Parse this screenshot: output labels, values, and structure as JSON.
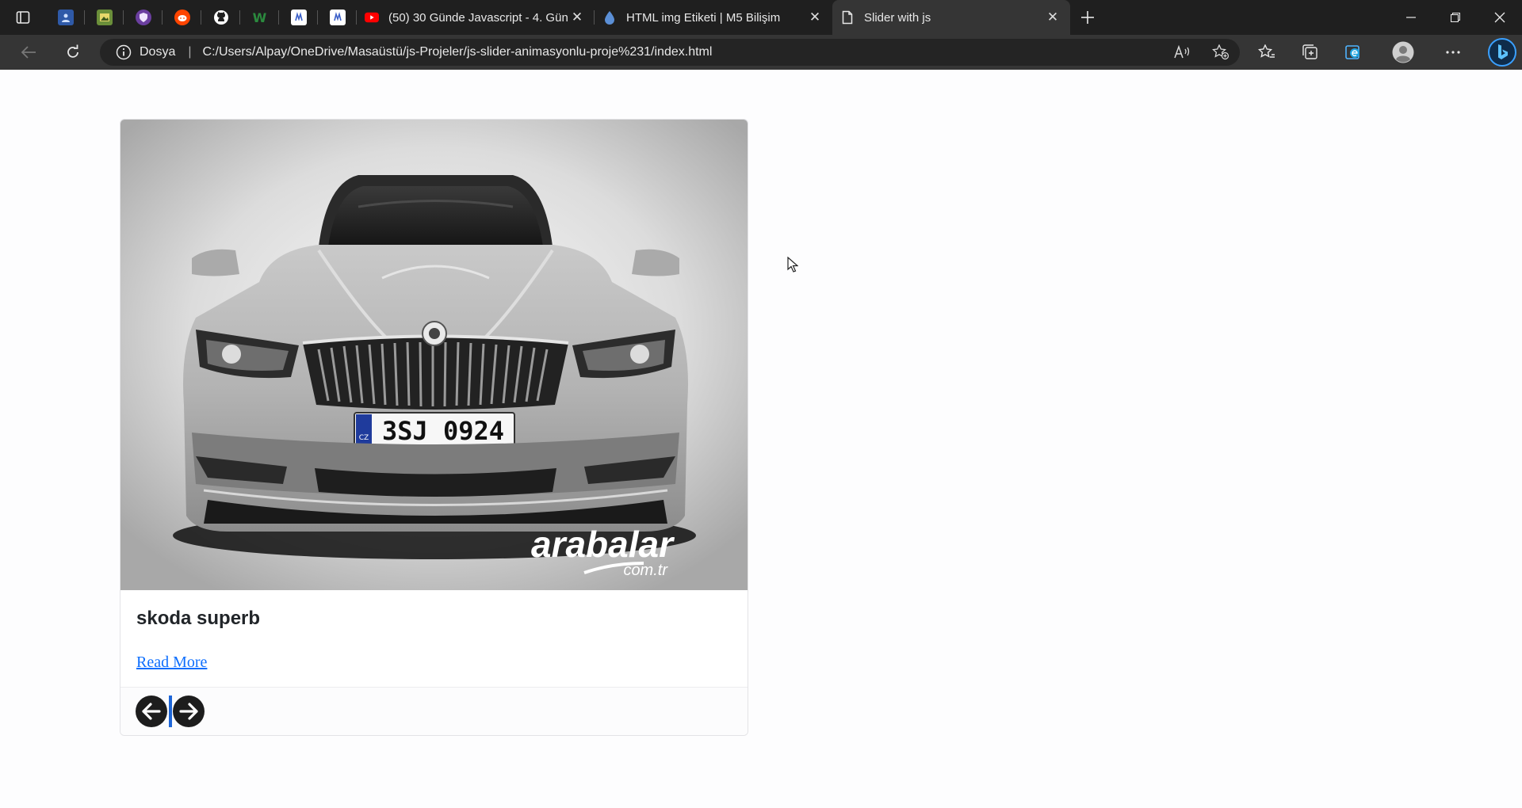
{
  "browser": {
    "pinned_tabs": [
      {
        "icon": "profile-card-icon",
        "color": "#2f5aa8"
      },
      {
        "icon": "image-gallery-icon",
        "color": "#6b8f3a"
      },
      {
        "icon": "shield-extension-icon",
        "color": "#6b3fa0"
      },
      {
        "icon": "reddit-icon",
        "color": "#ff4500"
      },
      {
        "icon": "github-icon",
        "color": "#ffffff"
      },
      {
        "icon": "w-logo-icon",
        "color": "#2b8a3e"
      },
      {
        "icon": "document-icon-a",
        "color": "#ffffff"
      },
      {
        "icon": "document-icon-b",
        "color": "#ffffff"
      }
    ],
    "tabs": [
      {
        "title": "(50) 30 Günde Javascript - 4. Gün",
        "icon": "youtube-icon"
      },
      {
        "title": "HTML img Etiketi | M5 Bilişim",
        "icon": "water-drop-icon"
      },
      {
        "title": "Slider with js",
        "icon": "page-icon",
        "active": true
      }
    ],
    "address": {
      "site_label": "Dosya",
      "url": "C:/Users/Alpay/OneDrive/Masaüstü/js-Projeler/js-slider-animasyonlu-proje%231/index.html"
    }
  },
  "card": {
    "title": "skoda superb",
    "link_text": "Read More",
    "image": {
      "plate_country": "CZ",
      "plate_text": "3SJ 0924",
      "watermark_main": "arabalar",
      "watermark_sub": "com.tr"
    },
    "controls": {
      "prev_icon": "arrow-left-icon",
      "next_icon": "arrow-right-icon"
    }
  },
  "colors": {
    "link": "#0d6efd",
    "chrome_dark": "#1f1f1f",
    "chrome_toolbar": "#353535",
    "caret": "#1e66d8"
  }
}
